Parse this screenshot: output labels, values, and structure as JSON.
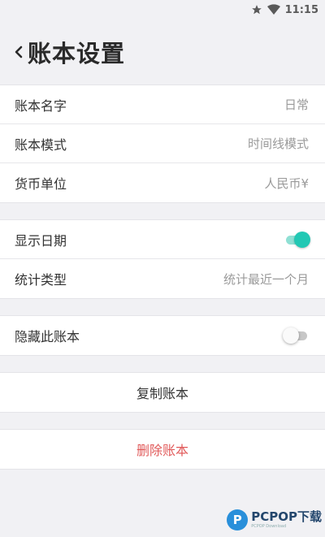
{
  "status_bar": {
    "time": "11:15",
    "icons": [
      "star-icon",
      "wifi-icon"
    ]
  },
  "header": {
    "title": "账本设置",
    "back_icon": "chevron-left-icon"
  },
  "groups": {
    "basic": [
      {
        "label": "账本名字",
        "value": "日常"
      },
      {
        "label": "账本模式",
        "value": "时间线模式"
      },
      {
        "label": "货币单位",
        "value": "人民币¥"
      }
    ],
    "display": {
      "show_date": {
        "label": "显示日期",
        "enabled": true
      },
      "stat_type": {
        "label": "统计类型",
        "value": "统计最近一个月"
      }
    },
    "privacy": {
      "hide_book": {
        "label": "隐藏此账本",
        "enabled": false
      }
    }
  },
  "actions": {
    "copy_label": "复制账本",
    "delete_label": "删除账本"
  },
  "watermark": {
    "logo_letter": "P",
    "main": "PCPOP下载",
    "sub": "PCPOP Download"
  },
  "colors": {
    "background": "#f1f1f4",
    "toggle_on": "#22c8b4",
    "delete": "#e15a5a"
  }
}
